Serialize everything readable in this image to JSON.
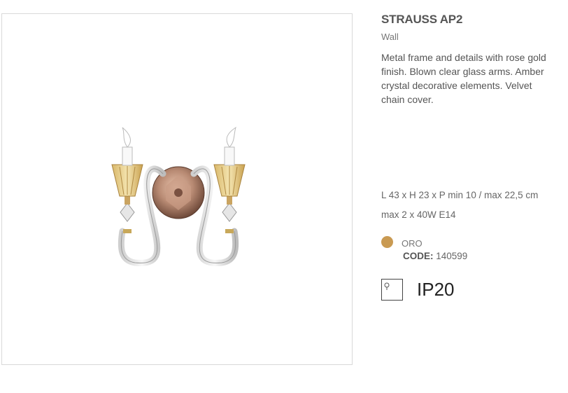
{
  "product": {
    "name": "STRAUSS AP2",
    "category": "Wall",
    "description": "Metal frame and details with rose gold finish. Blown clear glass arms. Amber crystal decorative elements. Velvet chain cover.",
    "dimensions": "L 43 x H 23 x P min 10 / max 22,5 cm",
    "power": "max 2 x 40W E14",
    "finish": {
      "name": "ORO",
      "color": "#c99a52",
      "code_label": "CODE:",
      "code_value": "140599"
    },
    "ip_rating": "IP20",
    "ip_icon": "ip-rating-icon"
  }
}
